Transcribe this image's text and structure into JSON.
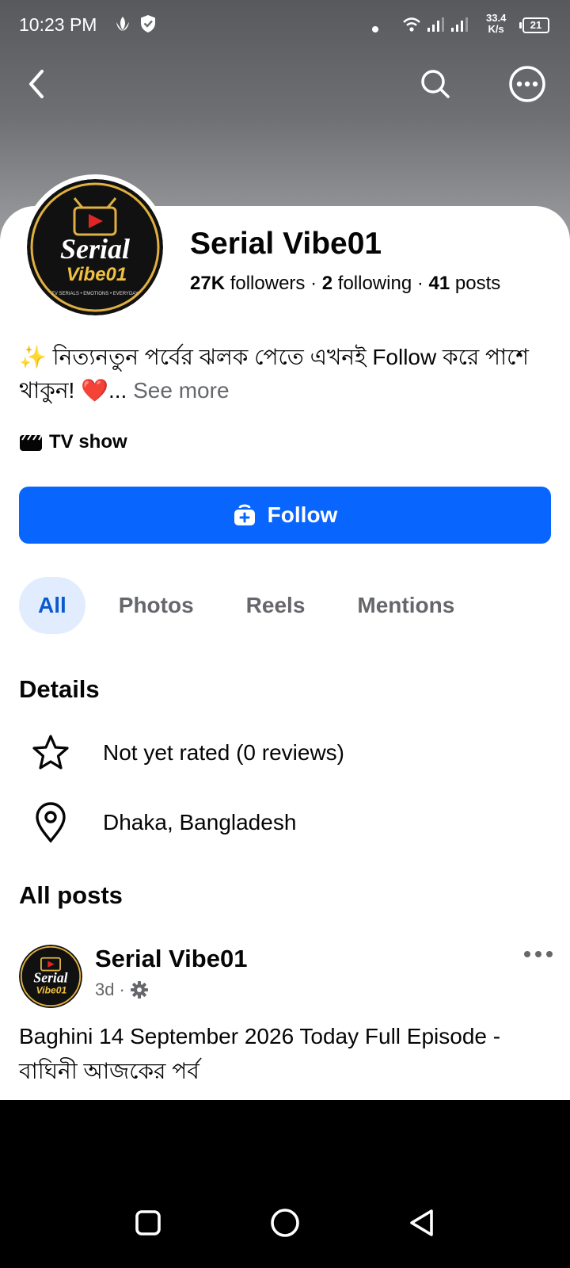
{
  "status_bar": {
    "time": "10:23 PM",
    "net_speed_value": "33.4",
    "net_speed_unit": "K/s",
    "battery": "21"
  },
  "nav": {
    "back_icon": "chevron-left-icon",
    "search_icon": "search-icon",
    "more_icon": "more-horizontal-circle-icon"
  },
  "profile": {
    "name": "Serial Vibe01",
    "followers_count": "27K",
    "followers_label": "followers",
    "following_count": "2",
    "following_label": "following",
    "posts_count": "41",
    "posts_label": "posts",
    "separator": "·",
    "avatar_text_top": "Serial",
    "avatar_text_bottom": "Vibe01",
    "avatar_tagline": "TV SERIALS • EMOTIONS • EVERYDAY"
  },
  "bio": {
    "emoji": "✨",
    "text": "নিত্যনতুন পর্বের ঝলক পেতে এখনই Follow করে পাশে থাকুন!",
    "heart": "❤️",
    "ellipsis": "...",
    "see_more": "See more"
  },
  "category": {
    "label": "TV show"
  },
  "follow_button": {
    "label": "Follow"
  },
  "tabs": [
    {
      "label": "All",
      "active": true
    },
    {
      "label": "Photos",
      "active": false
    },
    {
      "label": "Reels",
      "active": false
    },
    {
      "label": "Mentions",
      "active": false
    }
  ],
  "details": {
    "title": "Details",
    "rating": "Not yet rated (0 reviews)",
    "location": "Dhaka, Bangladesh"
  },
  "posts": {
    "title": "All posts",
    "items": [
      {
        "author": "Serial Vibe01",
        "time": "3d",
        "separator": "·",
        "text": "Baghini 14 September 2026 Today Full Episode - বাঘিনী আজকের পর্ব"
      }
    ]
  },
  "colors": {
    "accent": "#0866ff",
    "tab_active_bg": "#e1edfe",
    "muted": "#65676b"
  }
}
